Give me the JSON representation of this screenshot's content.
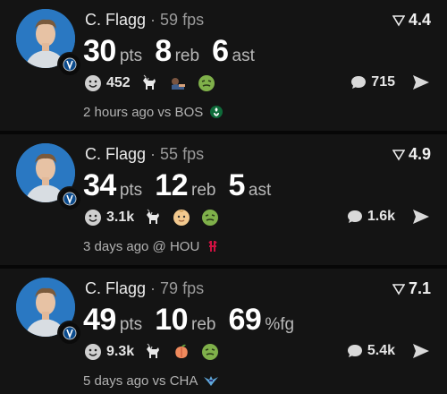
{
  "posts": [
    {
      "player": "C. Flagg",
      "fps_text": "59 fps",
      "rating": "4.4",
      "stats": [
        {
          "value": "30",
          "unit": "pts"
        },
        {
          "value": "8",
          "unit": "reb"
        },
        {
          "value": "6",
          "unit": "ast"
        }
      ],
      "reaction_count": "452",
      "reaction_icons": [
        "goat-icon",
        "bowing-person-icon",
        "nauseated-face-icon"
      ],
      "comment_count": "715",
      "time_text": "2 hours ago vs BOS",
      "opponent_logo": "celtics-logo"
    },
    {
      "player": "C. Flagg",
      "fps_text": "55 fps",
      "rating": "4.9",
      "stats": [
        {
          "value": "34",
          "unit": "pts"
        },
        {
          "value": "12",
          "unit": "reb"
        },
        {
          "value": "5",
          "unit": "ast"
        }
      ],
      "reaction_count": "3.1k",
      "reaction_icons": [
        "goat-icon",
        "baby-icon",
        "nauseated-face-icon"
      ],
      "comment_count": "1.6k",
      "time_text": "3 days ago @ HOU",
      "opponent_logo": "rockets-logo"
    },
    {
      "player": "C. Flagg",
      "fps_text": "79 fps",
      "rating": "7.1",
      "stats": [
        {
          "value": "49",
          "unit": "pts"
        },
        {
          "value": "10",
          "unit": "reb"
        },
        {
          "value": "69",
          "unit": "%fg"
        }
      ],
      "reaction_count": "9.3k",
      "reaction_icons": [
        "goat-icon",
        "peach-icon",
        "nauseated-face-icon"
      ],
      "comment_count": "5.4k",
      "time_text": "5 days ago vs CHA",
      "opponent_logo": "hornets-logo"
    }
  ],
  "colors": {
    "background": "#121212",
    "card": "#141414",
    "text_primary": "#ffffff",
    "text_secondary": "#b2b2b2",
    "team_blue": "#1f6fb3"
  }
}
